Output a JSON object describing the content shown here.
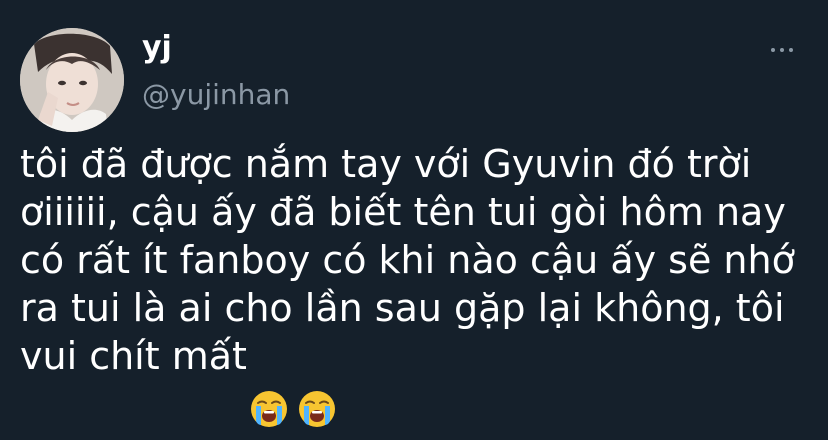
{
  "author": {
    "display_name": "yj",
    "handle": "@yujinhan"
  },
  "tweet": {
    "text": "tôi đã được nắm tay với Gyuvin đó trời\nơiiiiii, cậu ấy đã biết tên tui gòi hôm nay\ncó rất ít fanboy có khi nào cậu ấy sẽ nhớ\nra tui là ai cho lần sau gặp lại không, tôi\nvui chít mất",
    "emojis": [
      "loudly-crying-face-icon",
      "loudly-crying-face-icon"
    ]
  },
  "theme": {
    "background": "#15202b",
    "primary_text": "#ffffff",
    "secondary_text": "#8b98a5"
  }
}
